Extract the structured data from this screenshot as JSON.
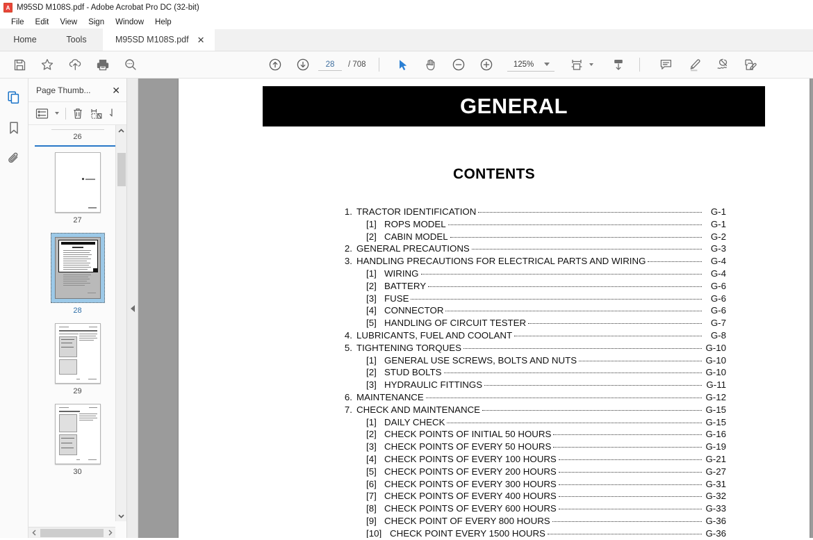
{
  "window": {
    "title": "M95SD M108S.pdf - Adobe Acrobat Pro DC (32-bit)",
    "app_icon": "pdf-document-icon"
  },
  "menubar": {
    "items": [
      {
        "label": "File"
      },
      {
        "label": "Edit"
      },
      {
        "label": "View"
      },
      {
        "label": "Sign"
      },
      {
        "label": "Window"
      },
      {
        "label": "Help"
      }
    ]
  },
  "tabs": {
    "home_label": "Home",
    "tools_label": "Tools",
    "document_label": "M95SD M108S.pdf",
    "close_glyph": "✕"
  },
  "toolbar": {
    "save_label": "save-file",
    "star_label": "add-to-favorites",
    "upload_label": "upload-to-cloud",
    "print_label": "print-file",
    "search_label": "find-text",
    "prev_page_label": "previous-page",
    "next_page_label": "next-page",
    "page_number": "28",
    "page_total": "/ 708",
    "page_placeholder": "28",
    "select_tool_label": "select-tool",
    "hand_tool_label": "hand-tool",
    "zoom_out_label": "zoom-out",
    "zoom_in_label": "zoom-in",
    "zoom_value": "125%",
    "fit_label": "fit-page-width",
    "scroll_mode_label": "page-display-mode",
    "comment_label": "add-comment",
    "highlight_label": "highlight-text",
    "draw_label": "draw-signature",
    "fill_sign_label": "fill-and-sign"
  },
  "rail": {
    "thumbnails_label": "page-thumbnails",
    "bookmarks_label": "bookmarks",
    "attachments_label": "attachments"
  },
  "thumbnail_panel": {
    "title": "Page Thumb...",
    "close_glyph": "✕",
    "size_label": "thumbnail-size-options",
    "delete_label": "delete-pages",
    "extract_label": "extract-pages",
    "insert_label": "insert-pages",
    "separator_number": "26",
    "pages": [
      {
        "number": "27",
        "selected": false
      },
      {
        "number": "28",
        "selected": true
      },
      {
        "number": "29",
        "selected": false
      },
      {
        "number": "30",
        "selected": false
      }
    ]
  },
  "document": {
    "banner": "GENERAL",
    "contents_heading": "CONTENTS",
    "toc": [
      {
        "num": "1.",
        "sub": "",
        "label": "TRACTOR IDENTIFICATION",
        "page": "G-1"
      },
      {
        "num": "",
        "sub": "[1]",
        "label": "ROPS MODEL",
        "page": "G-1"
      },
      {
        "num": "",
        "sub": "[2]",
        "label": "CABIN MODEL",
        "page": "G-2"
      },
      {
        "num": "2.",
        "sub": "",
        "label": "GENERAL PRECAUTIONS",
        "page": "G-3"
      },
      {
        "num": "3.",
        "sub": "",
        "label": "HANDLING PRECAUTIONS FOR ELECTRICAL PARTS AND WIRING",
        "page": "G-4"
      },
      {
        "num": "",
        "sub": "[1]",
        "label": "WIRING",
        "page": "G-4"
      },
      {
        "num": "",
        "sub": "[2]",
        "label": "BATTERY",
        "page": "G-6"
      },
      {
        "num": "",
        "sub": "[3]",
        "label": "FUSE",
        "page": "G-6"
      },
      {
        "num": "",
        "sub": "[4]",
        "label": "CONNECTOR",
        "page": "G-6"
      },
      {
        "num": "",
        "sub": "[5]",
        "label": "HANDLING OF CIRCUIT TESTER",
        "page": "G-7"
      },
      {
        "num": "4.",
        "sub": "",
        "label": "LUBRICANTS, FUEL AND COOLANT",
        "page": "G-8"
      },
      {
        "num": "5.",
        "sub": "",
        "label": "TIGHTENING TORQUES",
        "page": "G-10"
      },
      {
        "num": "",
        "sub": "[1]",
        "label": "GENERAL USE SCREWS, BOLTS AND NUTS",
        "page": "G-10"
      },
      {
        "num": "",
        "sub": "[2]",
        "label": "STUD BOLTS",
        "page": "G-10"
      },
      {
        "num": "",
        "sub": "[3]",
        "label": "HYDRAULIC FITTINGS",
        "page": "G-11"
      },
      {
        "num": "6.",
        "sub": "",
        "label": "MAINTENANCE",
        "page": "G-12"
      },
      {
        "num": "7.",
        "sub": "",
        "label": "CHECK AND MAINTENANCE",
        "page": "G-15"
      },
      {
        "num": "",
        "sub": "[1]",
        "label": "DAILY CHECK",
        "page": "G-15"
      },
      {
        "num": "",
        "sub": "[2]",
        "label": "CHECK POINTS OF INITIAL 50 HOURS",
        "page": "G-16"
      },
      {
        "num": "",
        "sub": "[3]",
        "label": "CHECK POINTS OF EVERY 50 HOURS",
        "page": "G-19"
      },
      {
        "num": "",
        "sub": "[4]",
        "label": "CHECK POINTS OF EVERY 100 HOURS",
        "page": "G-21"
      },
      {
        "num": "",
        "sub": "[5]",
        "label": "CHECK POINTS OF EVERY 200 HOURS",
        "page": "G-27"
      },
      {
        "num": "",
        "sub": "[6]",
        "label": "CHECK POINTS OF EVERY 300 HOURS",
        "page": "G-31"
      },
      {
        "num": "",
        "sub": "[7]",
        "label": "CHECK POINTS OF EVERY 400 HOURS",
        "page": "G-32"
      },
      {
        "num": "",
        "sub": "[8]",
        "label": "CHECK POINTS OF EVERY 600 HOURS",
        "page": "G-33"
      },
      {
        "num": "",
        "sub": "[9]",
        "label": "CHECK POINT OF EVERY 800 HOURS",
        "page": "G-36"
      },
      {
        "num": "",
        "sub": "[10]",
        "label": "CHECK POINT EVERY 1500 HOURS",
        "page": "G-36"
      }
    ]
  },
  "colors": {
    "accent_blue": "#2878c8",
    "selection_blue": "#9cc9e8",
    "viewer_backdrop": "#9b9b9b",
    "banner_black": "#000000",
    "pdf_red": "#e8453c"
  }
}
